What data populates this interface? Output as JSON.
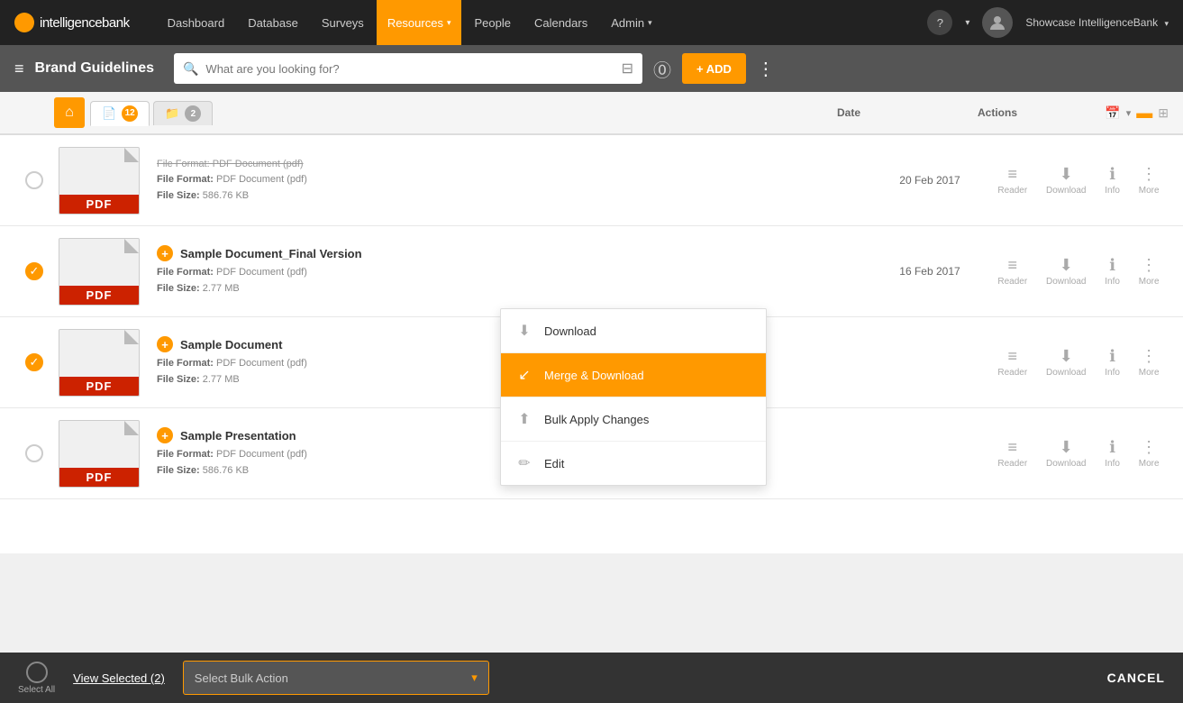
{
  "topNav": {
    "logoText": "intelligencebank",
    "links": [
      {
        "label": "Dashboard",
        "active": false
      },
      {
        "label": "Database",
        "active": false
      },
      {
        "label": "Surveys",
        "active": false
      },
      {
        "label": "Resources",
        "active": true,
        "hasArrow": true
      },
      {
        "label": "People",
        "active": false
      },
      {
        "label": "Calendars",
        "active": false
      },
      {
        "label": "Admin",
        "active": false,
        "hasArrow": true
      }
    ],
    "userName": "Showcase IntelligenceBank",
    "helpTitle": "?"
  },
  "toolbar": {
    "hamburgerLabel": "≡",
    "pageTitle": "Brand Guidelines",
    "searchPlaceholder": "What are you looking for?",
    "addLabel": "+ ADD"
  },
  "fileTabs": {
    "fileTab": {
      "icon": "📄",
      "count": 12
    },
    "folderTab": {
      "icon": "📁",
      "count": 2
    }
  },
  "tableHeader": {
    "dateLabel": "Date",
    "actionsLabel": "Actions"
  },
  "files": [
    {
      "id": "file1",
      "checked": false,
      "name": "",
      "fileFormat": "PDF Document (pdf)",
      "fileSize": "586.76 KB",
      "date": "20 Feb 2017",
      "actions": [
        "Reader",
        "Download",
        "Info",
        "More"
      ],
      "isPartial": true
    },
    {
      "id": "file2",
      "checked": true,
      "name": "Sample Document_Final Version",
      "fileFormat": "PDF Document (pdf)",
      "fileSize": "2.77 MB",
      "date": "16 Feb 2017",
      "actions": [
        "Reader",
        "Download",
        "Info",
        "More"
      ]
    },
    {
      "id": "file3",
      "checked": true,
      "name": "Sample Document",
      "fileFormat": "PDF Document (pdf)",
      "fileSize": "2.77 MB",
      "date": "",
      "actions": [
        "Reader",
        "Download",
        "Info",
        "More"
      ],
      "hasDropdown": true
    },
    {
      "id": "file4",
      "checked": false,
      "name": "Sample Presentation",
      "fileFormat": "PDF Document (pdf)",
      "fileSize": "586.76 KB",
      "date": "",
      "actions": [
        "Reader",
        "Download",
        "Info",
        "More"
      ]
    }
  ],
  "dropdown": {
    "items": [
      {
        "label": "Download",
        "icon": "⬇",
        "highlighted": false
      },
      {
        "label": "Merge & Download",
        "icon": "↙",
        "highlighted": true
      },
      {
        "label": "Bulk Apply Changes",
        "icon": "⬆",
        "highlighted": false
      },
      {
        "label": "Edit",
        "icon": "✏",
        "highlighted": false
      }
    ]
  },
  "bottomBar": {
    "selectAllLabel": "Select All",
    "viewSelectedLabel": "View Selected (2)",
    "bulkActionPlaceholder": "Select Bulk Action",
    "cancelLabel": "CANCEL"
  }
}
